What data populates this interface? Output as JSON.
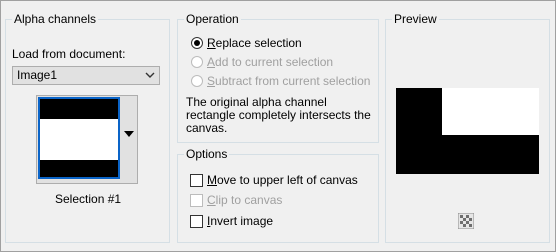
{
  "alpha_channels": {
    "title": "Alpha channels",
    "load_label": "Load from document:",
    "document_value": "Image1",
    "selection_label": "Selection #1"
  },
  "operation": {
    "title": "Operation",
    "options": [
      {
        "label": "Replace selection",
        "selected": true,
        "enabled": true
      },
      {
        "label": "Add to current selection",
        "selected": false,
        "enabled": false
      },
      {
        "label": "Subtract from current selection",
        "selected": false,
        "enabled": false
      }
    ],
    "message": [
      "The original alpha channel",
      "rectangle completely intersects the",
      "canvas."
    ]
  },
  "options": {
    "title": "Options",
    "move_label": "Move to upper left of canvas",
    "clip_label": "Clip to canvas",
    "invert_label": "Invert image"
  },
  "preview": {
    "title": "Preview",
    "icon": "checker-pattern-icon"
  },
  "colors": {
    "accent": "#0a64c8",
    "group_border": "#d5dfe5",
    "disabled_text": "#a0a0a0"
  }
}
